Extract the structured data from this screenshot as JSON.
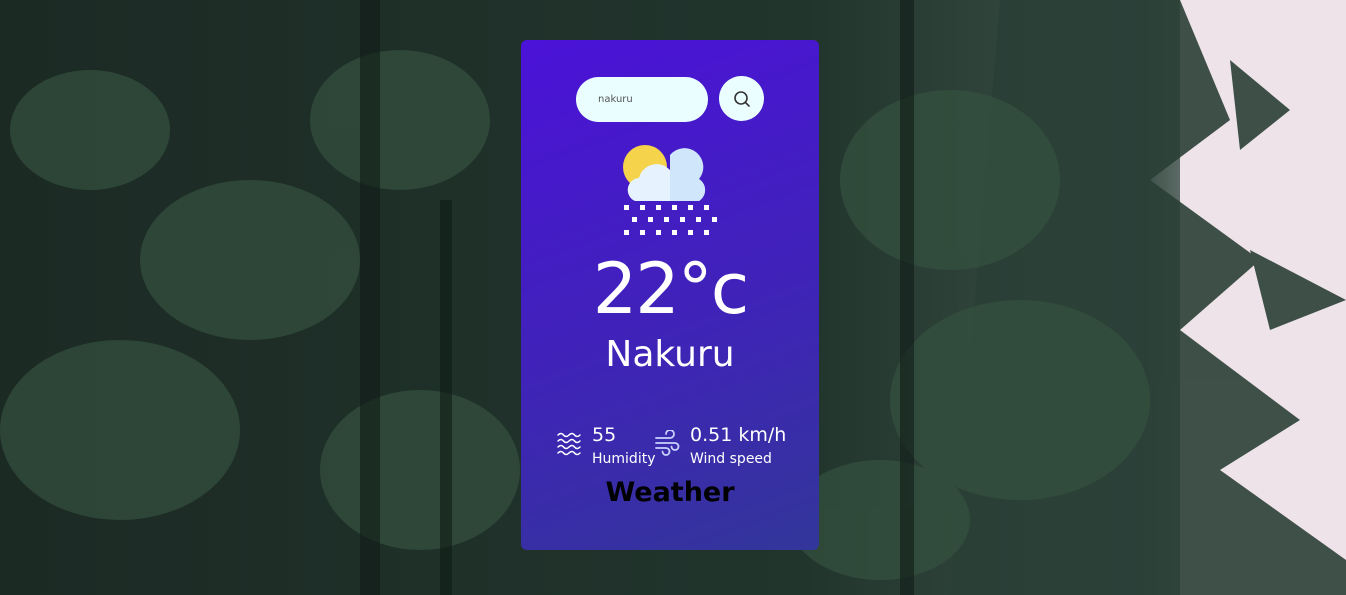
{
  "search": {
    "value": "nakuru",
    "button_icon": "search-icon"
  },
  "weather": {
    "condition_icon": "sun-cloud-snow-icon",
    "temperature": "22°c",
    "city": "Nakuru"
  },
  "details": {
    "humidity_value": "55",
    "humidity_label": "Humidity",
    "humidity_icon": "humidity-waves-icon",
    "wind_value": "0.51 km/h",
    "wind_label": "Wind speed",
    "wind_icon": "wind-icon"
  },
  "brand": "Weather",
  "colors": {
    "card_top": "#4b12d8",
    "card_bottom": "#33369a",
    "input_bg": "#ebfeff",
    "text": "#ffffff"
  }
}
